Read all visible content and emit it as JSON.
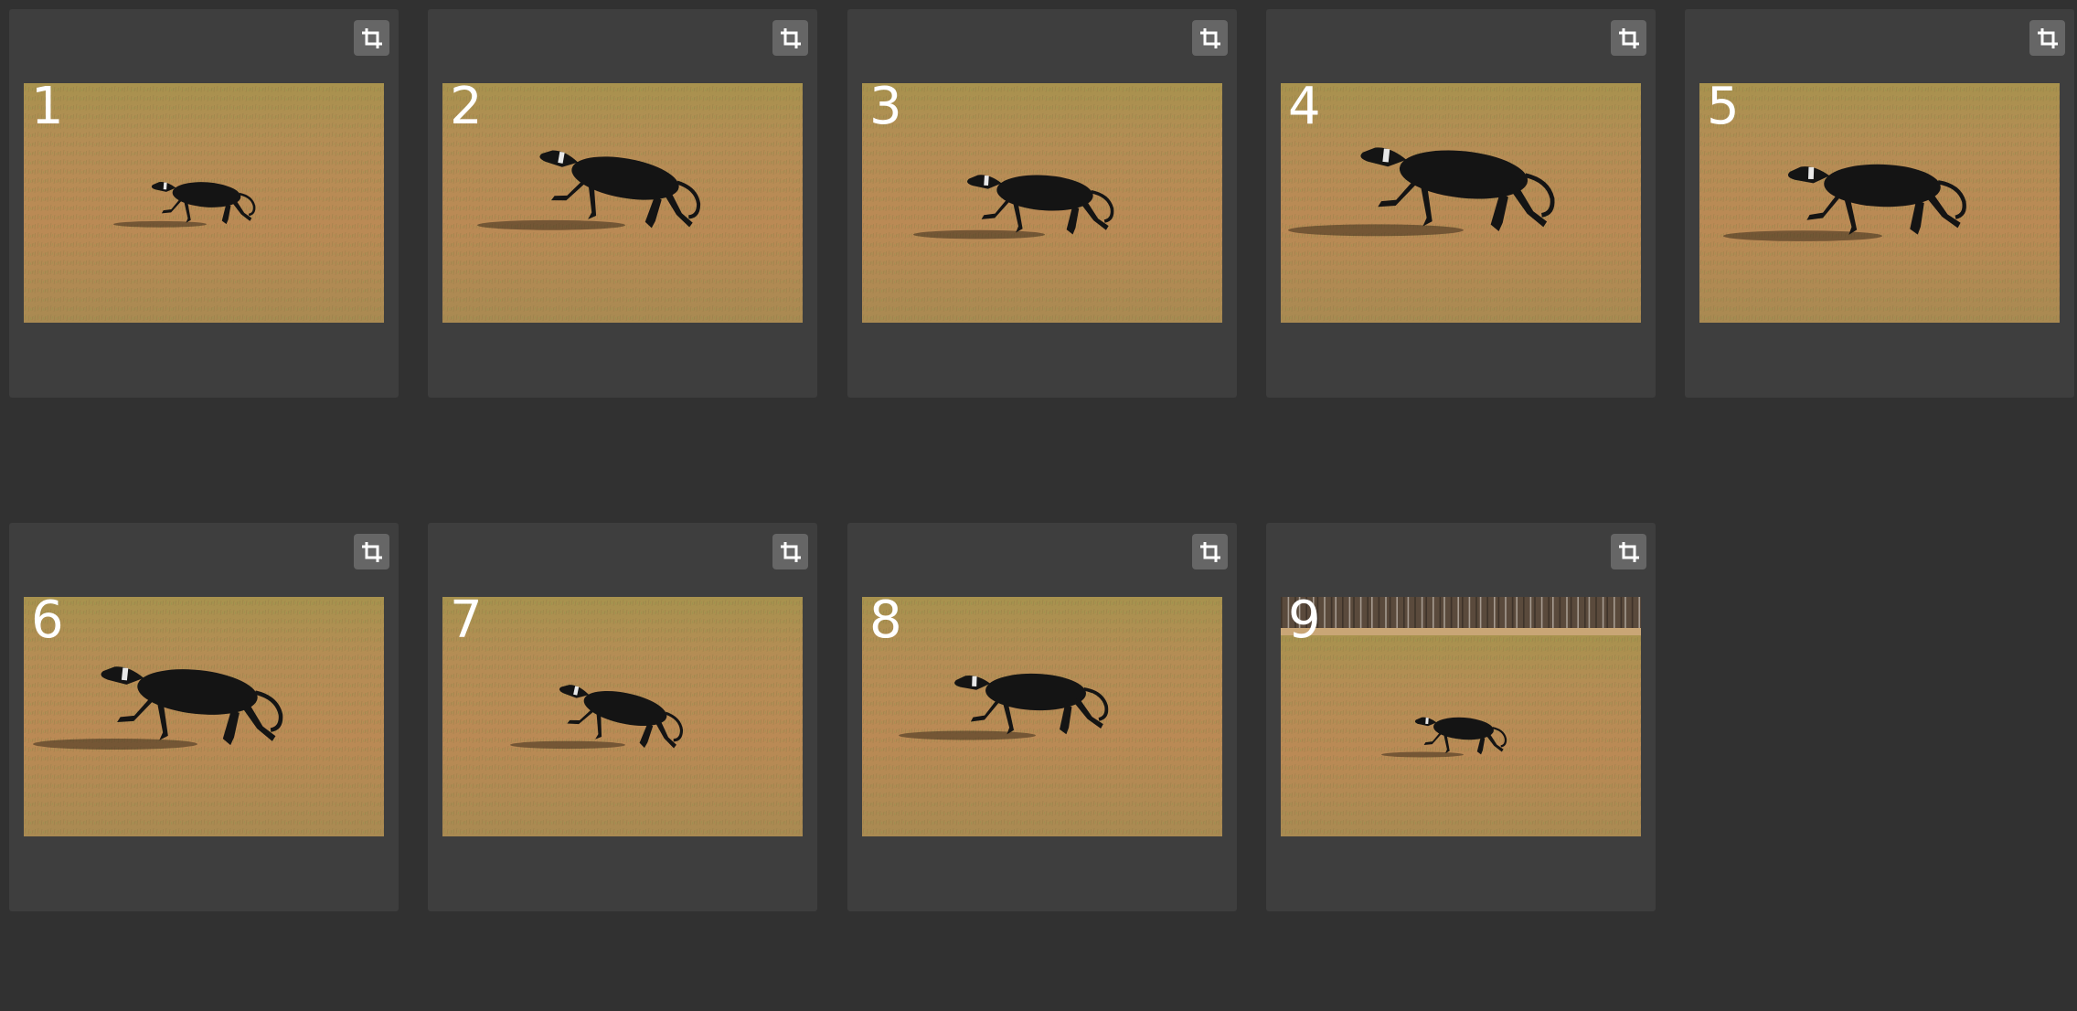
{
  "gallery": {
    "frames": [
      {
        "number": "1",
        "icon": "crop-icon"
      },
      {
        "number": "2",
        "icon": "crop-icon"
      },
      {
        "number": "3",
        "icon": "crop-icon"
      },
      {
        "number": "4",
        "icon": "crop-icon"
      },
      {
        "number": "5",
        "icon": "crop-icon"
      },
      {
        "number": "6",
        "icon": "crop-icon"
      },
      {
        "number": "7",
        "icon": "crop-icon"
      },
      {
        "number": "8",
        "icon": "crop-icon"
      },
      {
        "number": "9",
        "icon": "crop-icon"
      }
    ]
  },
  "colors": {
    "background": "#313131",
    "card": "#3e3e3e",
    "button": "#666666",
    "grass": "#b58a52",
    "dog": "#141414"
  }
}
